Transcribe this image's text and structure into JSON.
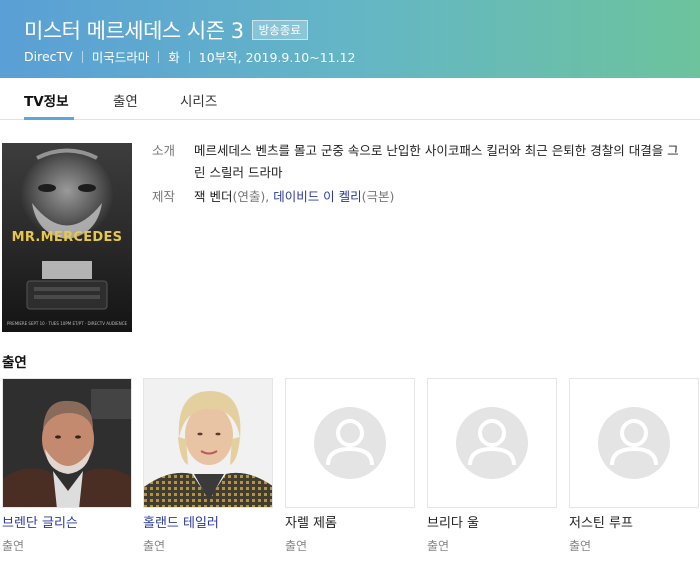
{
  "header": {
    "title": "미스터 메르세데스 시즌 3",
    "badge": "방송종료",
    "meta": [
      "DirecTV",
      "미국드라마",
      "화",
      "10부작, 2019.9.10~11.12"
    ],
    "gradient": [
      "#5a9fd6",
      "#6cc39c"
    ]
  },
  "tabs": [
    {
      "label": "TV정보",
      "active": true
    },
    {
      "label": "출연",
      "active": false
    },
    {
      "label": "시리즈",
      "active": false
    }
  ],
  "poster": {
    "title_text": "MR.MERCEDES",
    "credit_text": "PREMIERE SEPT 10 · TUES 10PM ET/PT · DIRECTV AUDIENCE"
  },
  "info": {
    "intro_label": "소개",
    "intro_text": "메르세데스 벤츠를 몰고 군중 속으로 난입한 사이코패스 킬러와 최근 은퇴한 경찰의 대결을 그린 스릴러 드라마",
    "production_label": "제작",
    "director_name": "잭 벤더",
    "director_role": "(연출),",
    "writer_name": "데이비드 이 켈리",
    "writer_role": "(극본)"
  },
  "cast": {
    "title": "출연",
    "members": [
      {
        "name": "브렌단 글리슨",
        "role": "출연",
        "has_photo": true
      },
      {
        "name": "홀랜드 테일러",
        "role": "출연",
        "has_photo": true
      },
      {
        "name": "자렐 제롬",
        "role": "출연",
        "has_photo": false
      },
      {
        "name": "브리다 울",
        "role": "출연",
        "has_photo": false
      },
      {
        "name": "저스틴 루프",
        "role": "출연",
        "has_photo": false
      }
    ]
  },
  "colors": {
    "link": "#2b3a9a",
    "tab_underline": "#5aa7d8"
  }
}
